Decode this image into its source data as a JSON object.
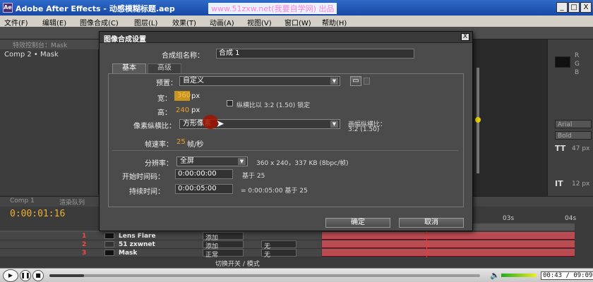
{
  "window": {
    "app_icon_text": "Ae",
    "title": "Adobe After Effects - 动感模糊标题.aep",
    "watermark": "www.51zxw.net(我要自学网) 出品",
    "min": "_",
    "max": "□",
    "close": "X"
  },
  "menu": [
    "文件(F)",
    "编辑(E)",
    "图像合成(C)",
    "图层(L)",
    "效果(T)",
    "动画(A)",
    "视图(V)",
    "窗口(W)",
    "帮助(H)"
  ],
  "left_panel": {
    "tab": "特效控制台：Mask",
    "comp_label": "Comp 2 • Mask"
  },
  "right_panel": {
    "letters": [
      "R",
      "G",
      "B"
    ],
    "font": "Arial",
    "style": "Bold",
    "size": "47 px",
    "leading": "12 px"
  },
  "dialog": {
    "title": "图像合成设置",
    "close": "X",
    "name_label": "合成组名称：",
    "name_value": "合成 1",
    "tabs": {
      "basic": "基本",
      "advanced": "高级"
    },
    "preset_label": "预置：",
    "preset_value": "自定义",
    "width_label": "宽：",
    "width_value": "360",
    "height_label": "高：",
    "height_value": "240",
    "px": "px",
    "lock_aspect_label": "纵横比以 3:2 (1.50) 锁定",
    "pixel_aspect_label": "像素纵横比：",
    "pixel_aspect_value": "方形像素",
    "frame_aspect_label": "画幅纵横比：",
    "frame_aspect_value": "3:2 (1.50)",
    "fps_label": "帧速率：",
    "fps_value": "25",
    "fps_unit": "帧/秒",
    "resolution_label": "分辨率：",
    "resolution_value": "全屏",
    "resolution_info": "360 x 240，337 KB (8bpc/帧)",
    "start_tc_label": "开始时间码：",
    "start_tc_value": "0:00:00:00",
    "start_tc_base": "基于 25",
    "duration_label": "持续时间：",
    "duration_value": "0:00:05:00",
    "duration_info": "= 0:00:05:00  基于 25",
    "ok": "确定",
    "cancel": "取消"
  },
  "timeline": {
    "tabs": [
      "Comp 1",
      "渲染队列"
    ],
    "timecode": "0:00:01:16",
    "ruler": [
      "03s",
      "04s"
    ],
    "layers": [
      {
        "num": "1",
        "name": "Lens Flare",
        "mode": "添加",
        "trk": ""
      },
      {
        "num": "2",
        "name": "51 zxwnet",
        "mode": "添加",
        "trk": "无"
      },
      {
        "num": "3",
        "name": "Mask",
        "mode": "正常",
        "trk": "无"
      }
    ],
    "switch_label": "切换开关 / 模式"
  },
  "player": {
    "time": "00:43 / 09:09",
    "progress": 0.08
  }
}
